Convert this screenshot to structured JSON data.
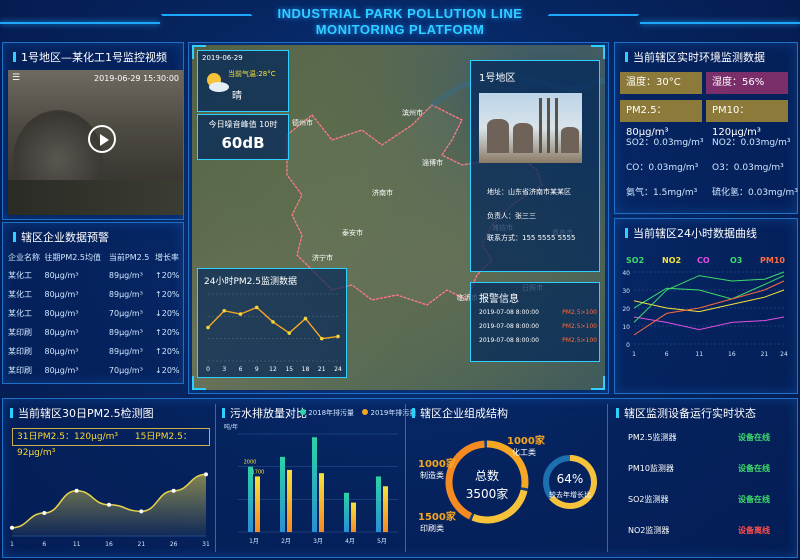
{
  "header": {
    "title_line1": "INDUSTRIAL PARK POLLUTION LINE",
    "title_line2": "MONITORING PLATFORM"
  },
  "colors": {
    "accent": "#2fd0ff",
    "warning": "#f5a623",
    "good": "#3ddc6a",
    "bad": "#ff4d4d"
  },
  "video_panel": {
    "title": "1号地区—某化工1号监控视频",
    "timestamp": "2019-06-29 15:30:00",
    "menu_icon": "menu-icon",
    "play_icon": "play-icon"
  },
  "enterprise_panel": {
    "title": "辖区企业数据预警",
    "headers": [
      "企业名称",
      "往期PM2.5均值",
      "当前PM2.5",
      "增长率"
    ],
    "rows": [
      {
        "name": "某化工",
        "past": "80μg/m³",
        "current": "89μg/m³",
        "rate": "↑20%",
        "rate_status": "good"
      },
      {
        "name": "某化工",
        "past": "80μg/m³",
        "current": "89μg/m³",
        "rate": "↑20%",
        "rate_status": "good"
      },
      {
        "name": "某化工",
        "past": "80μg/m³",
        "current": "70μg/m³",
        "rate": "↓20%",
        "rate_status": "bad"
      },
      {
        "name": "某印刷",
        "past": "80μg/m³",
        "current": "89μg/m³",
        "rate": "↑20%",
        "rate_status": "good"
      },
      {
        "name": "某印刷",
        "past": "80μg/m³",
        "current": "89μg/m³",
        "rate": "↑20%",
        "rate_status": "good"
      },
      {
        "name": "某印刷",
        "past": "80μg/m³",
        "current": "70μg/m³",
        "rate": "↓20%",
        "rate_status": "bad"
      }
    ]
  },
  "map_panel": {
    "weather": {
      "date": "2019-06-29",
      "temp": "当前气温:28°C",
      "condition": "晴",
      "icon": "sun-cloud-icon"
    },
    "noise": {
      "label": "今日噪音峰值  10时",
      "value": "60dB"
    },
    "area": {
      "title": "1号地区",
      "address": "地址：山东省济南市某某区",
      "owner": "负责人：张三三",
      "phone": "联系方式：155 5555 5555"
    },
    "alarm": {
      "title": "报警信息",
      "items": [
        {
          "date": "2019-07-08",
          "time": "8:00:00",
          "value": "PM2.5>100"
        },
        {
          "date": "2019-07-08",
          "time": "8:00:00",
          "value": "PM2.5>100"
        },
        {
          "date": "2019-07-08",
          "time": "8:00:00",
          "value": "PM2.5>100"
        }
      ]
    },
    "pm24": {
      "title": "24小时PM2.5监测数据"
    },
    "place_labels": [
      "济南市",
      "淄博市",
      "潍坊市",
      "泰安市",
      "临沂市",
      "济宁市",
      "烟台市",
      "青岛市",
      "日照市",
      "德州市",
      "滨州市",
      "东营市"
    ]
  },
  "env_panel": {
    "title": "当前辖区实时环境监测数据",
    "highlighted": [
      {
        "label": "温度：30°C",
        "bg": "#8c7a3a"
      },
      {
        "label": "湿度：56%",
        "bg": "#7a2f6b"
      },
      {
        "label": "PM2.5：80μg/m³",
        "bg": "#8c7a3a"
      },
      {
        "label": "PM10：120μg/m³",
        "bg": "#8c7a3a"
      }
    ],
    "values": [
      {
        "label": "SO2：0.03mg/m³"
      },
      {
        "label": "NO2：0.03mg/m³"
      },
      {
        "label": "CO：0.03mg/m³"
      },
      {
        "label": "O3：0.03mg/m³"
      },
      {
        "label": "氨气：1.5mg/m³"
      },
      {
        "label": "硫化氢：0.03mg/m³"
      }
    ]
  },
  "curve_panel": {
    "title": "当前辖区24小时数据曲线",
    "legend": [
      {
        "name": "SO2",
        "color": "#3ddc6a"
      },
      {
        "name": "NO2",
        "color": "#f5e23a"
      },
      {
        "name": "CO",
        "color": "#e04ee0"
      },
      {
        "name": "O3",
        "color": "#3ddc6a"
      },
      {
        "name": "PM10",
        "color": "#ff6a3a"
      }
    ]
  },
  "bottom": {
    "pm30_title": "当前辖区30日PM2.5检测图",
    "pm30_summary_31": "31日PM2.5：120μg/m³",
    "pm30_summary_15": "15日PM2.5：92μg/m³",
    "discharge_title": "污水排放量对比",
    "discharge_legend": [
      "2018年排污量",
      "2019年排污量"
    ],
    "structure_title": "辖区企业组成结构",
    "structure": {
      "total_label": "总数",
      "total_value": "3500家",
      "mfg_count": "1000家",
      "mfg_label": "制造类",
      "chem_count": "1000家",
      "chem_label": "化工类",
      "print_count": "1500家",
      "print_label": "印刷类",
      "growth_value": "64%",
      "growth_label": "较去年增长比"
    },
    "status_title": "辖区监测设备运行实时状态",
    "devices": [
      {
        "name": "PM2.5监测器",
        "status": "设备在线",
        "state": "online"
      },
      {
        "name": "PM10监测器",
        "status": "设备在线",
        "state": "online"
      },
      {
        "name": "SO2监测器",
        "status": "设备在线",
        "state": "online"
      },
      {
        "name": "NO2监测器",
        "status": "设备离线",
        "state": "offline"
      }
    ]
  },
  "chart_data": [
    {
      "type": "line",
      "title": "24小时PM2.5监测数据",
      "x": [
        0,
        3,
        6,
        9,
        12,
        15,
        18,
        21,
        24
      ],
      "x_tick_labels": [
        "0",
        "3",
        "6",
        "9",
        "12",
        "15",
        "18",
        "21",
        "24"
      ],
      "series": [
        {
          "values": [
            30,
            45,
            42,
            48,
            35,
            25,
            38,
            20,
            22
          ]
        }
      ],
      "ylim": [
        0,
        60
      ]
    },
    {
      "type": "line",
      "title": "当前辖区24小时数据曲线",
      "x": [
        1,
        6,
        11,
        16,
        21,
        24
      ],
      "x_tick_labels": [
        "1",
        "6",
        "11",
        "16",
        "21",
        "24"
      ],
      "ylim": [
        0,
        40
      ],
      "y_ticks": [
        0,
        10,
        20,
        30,
        40
      ],
      "series": [
        {
          "name": "SO2",
          "color": "#3ddc6a",
          "values": [
            20,
            31,
            30,
            25,
            33,
            38
          ]
        },
        {
          "name": "NO2",
          "color": "#f5e23a",
          "values": [
            24,
            20,
            18,
            22,
            26,
            30
          ]
        },
        {
          "name": "CO",
          "color": "#e04ee0",
          "values": [
            15,
            12,
            8,
            12,
            13,
            15
          ]
        },
        {
          "name": "O3",
          "color": "#3ddc6a",
          "values": [
            12,
            30,
            38,
            35,
            36,
            40
          ]
        },
        {
          "name": "PM10",
          "color": "#ff6a3a",
          "values": [
            5,
            17,
            20,
            25,
            30,
            35
          ]
        }
      ]
    },
    {
      "type": "area",
      "title": "当前辖区30日PM2.5检测图",
      "x": [
        1,
        6,
        11,
        16,
        21,
        26,
        31
      ],
      "x_tick_labels": [
        "1",
        "6",
        "11",
        "16",
        "21",
        "26",
        "31"
      ],
      "series": [
        {
          "values": [
            10,
            28,
            55,
            38,
            30,
            55,
            75
          ]
        }
      ],
      "ylim": [
        0,
        90
      ]
    },
    {
      "type": "bar",
      "title": "污水排放量对比",
      "ylabel": "吨/年",
      "categories": [
        "1月",
        "2月",
        "3月",
        "4月",
        "5月"
      ],
      "ylim": [
        0,
        3000
      ],
      "series": [
        {
          "name": "2018年排污量",
          "values": [
            2000,
            2300,
            2900,
            1200,
            1700
          ]
        },
        {
          "name": "2019年排污量",
          "values": [
            1700,
            1900,
            1800,
            900,
            1400
          ]
        }
      ],
      "data_labels": [
        "2000",
        "1700"
      ]
    },
    {
      "type": "pie",
      "title": "辖区企业组成结构",
      "categories": [
        "制造类",
        "化工类",
        "印刷类"
      ],
      "values": [
        1000,
        1000,
        1500
      ]
    }
  ]
}
